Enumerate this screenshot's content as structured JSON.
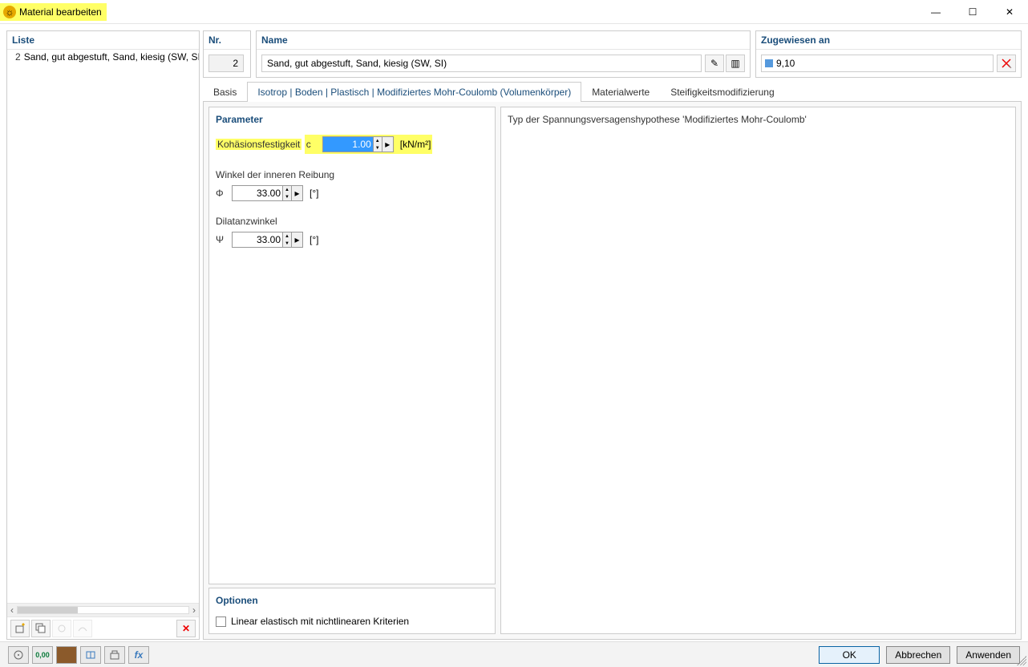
{
  "window": {
    "title": "Material bearbeiten"
  },
  "list": {
    "header": "Liste",
    "items": [
      {
        "swatch": "#8b5a2b",
        "num": "2",
        "name": "Sand, gut abgestuft, Sand, kiesig (SW, SI)"
      }
    ]
  },
  "nr": {
    "header": "Nr.",
    "value": "2"
  },
  "name": {
    "header": "Name",
    "value": "Sand, gut abgestuft, Sand, kiesig (SW, SI)"
  },
  "assigned": {
    "header": "Zugewiesen an",
    "value": "9,10"
  },
  "tabs": {
    "basis": "Basis",
    "isotrop": "Isotrop | Boden | Plastisch | Modifiziertes Mohr-Coulomb (Volumenkörper)",
    "materialwerte": "Materialwerte",
    "steifigkeit": "Steifigkeitsmodifizierung"
  },
  "parameter": {
    "title": "Parameter",
    "cohesion": {
      "label": "Kohäsionsfestigkeit",
      "symbol": "c",
      "value": "1.00",
      "unit": "[kN/m²]"
    },
    "friction": {
      "label": "Winkel der inneren Reibung",
      "symbol": "Φ",
      "value": "33.00",
      "unit": "[°]"
    },
    "dilatancy": {
      "label": "Dilatanzwinkel",
      "symbol": "Ψ",
      "value": "33.00",
      "unit": "[°]"
    }
  },
  "options": {
    "title": "Optionen",
    "linear": "Linear elastisch mit nichtlinearen Kriterien"
  },
  "info": {
    "text": "Typ der Spannungsversagenshypothese 'Modifiziertes Mohr-Coulomb'"
  },
  "footer": {
    "ok": "OK",
    "cancel": "Abbrechen",
    "apply": "Anwenden"
  },
  "icons": {
    "chevL": "‹",
    "chevR": "›",
    "up": "▲",
    "down": "▼",
    "right": "▸",
    "min": "—",
    "max": "☐",
    "close": "✕",
    "edit": "✎",
    "book": "▥",
    "remove": "✕",
    "new": "☼",
    "copy": "⧉",
    "delete": "✕",
    "search": "🔍",
    "units": "0̲,0̲0̲"
  }
}
